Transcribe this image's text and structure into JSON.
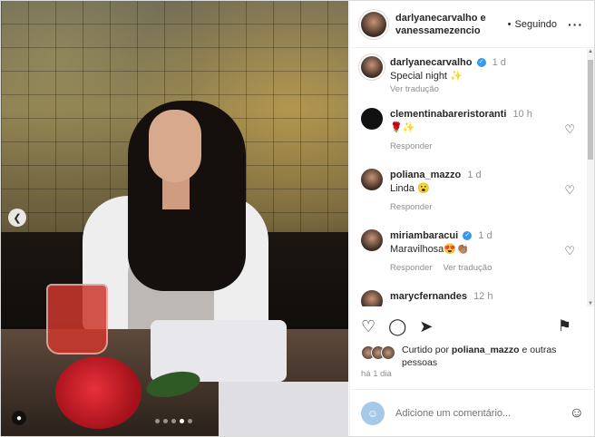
{
  "post": {
    "header": {
      "names_line1": "darlyanecarvalho e",
      "names_line2": "vanessamezencio",
      "follow_label": "Seguindo",
      "more_icon": "more-icon"
    },
    "caption": {
      "user": "darlyanecarvalho",
      "time": "1 d",
      "text": "Special night ✨",
      "translate": "Ver tradução"
    },
    "comments": [
      {
        "user": "clementinabareristoranti",
        "time": "10 h",
        "text": "🌹✨",
        "reply": "Responder",
        "translate": ""
      },
      {
        "user": "poliana_mazzo",
        "time": "1 d",
        "text": "Linda 😮",
        "reply": "Responder",
        "translate": ""
      },
      {
        "user": "miriambaracui",
        "time": "1 d",
        "text": "Maravilhosa😍👏🏽",
        "reply": "Responder",
        "translate": "Ver tradução"
      },
      {
        "user": "marycfernandes",
        "time": "12 h",
        "text": "",
        "reply": "",
        "translate": ""
      }
    ],
    "likes": {
      "prefix": "Curtido por",
      "user": "poliana_mazzo",
      "suffix": "e outras",
      "suffix2": "pessoas"
    },
    "time_ago": "há 1 dia",
    "add_comment_placeholder": "Adicione um comentário...",
    "carousel": {
      "total": 5,
      "active": 4
    }
  }
}
